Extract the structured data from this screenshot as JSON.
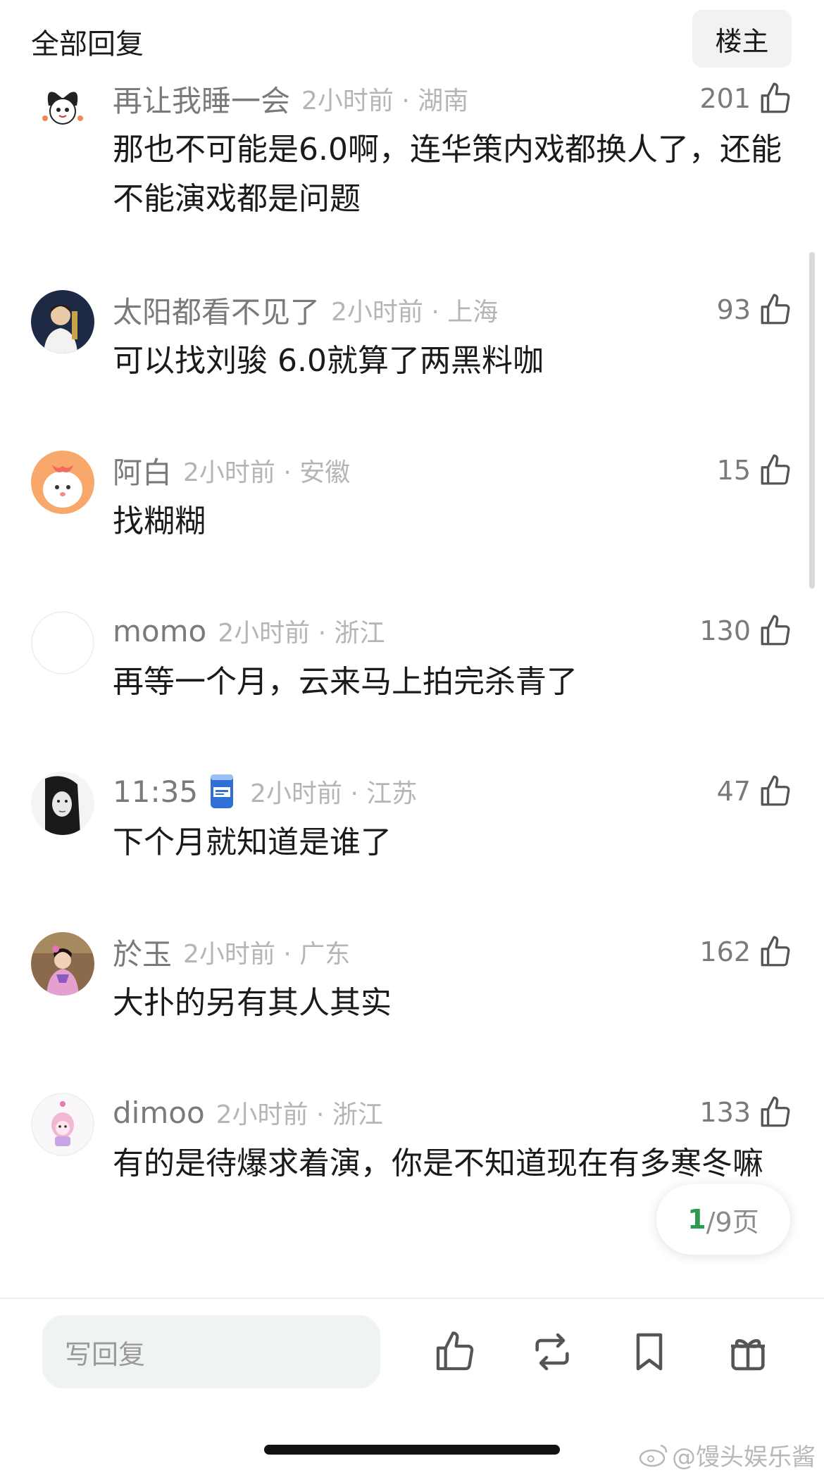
{
  "header": {
    "title": "全部回复",
    "op_toggle": "楼主"
  },
  "comments": [
    {
      "user": "再让我睡一会",
      "time": "2小时前 · 湖南",
      "likes": "201",
      "text": "那也不可能是6.0啊，连华策内戏都换人了，还能不能演戏都是问题"
    },
    {
      "user": "太阳都看不见了",
      "time": "2小时前 · 上海",
      "likes": "93",
      "text": "可以找刘骏 6.0就算了两黑料咖"
    },
    {
      "user": "阿白",
      "time": "2小时前 · 安徽",
      "likes": "15",
      "text": "找糊糊"
    },
    {
      "user": "momo",
      "time": "2小时前 · 浙江",
      "likes": "130",
      "text": "再等一个月，云来马上拍完杀青了"
    },
    {
      "user": "11:35",
      "time": "2小时前 · 江苏",
      "likes": "47",
      "text": "下个月就知道是谁了"
    },
    {
      "user": "於玉",
      "time": "2小时前 · 广东",
      "likes": "162",
      "text": "大扑的另有其人其实"
    },
    {
      "user": "dimoo",
      "time": "2小时前 · 浙江",
      "likes": "133",
      "text": "有的是待爆求着演，你是不知道现在有多寒冬嘛"
    }
  ],
  "pager": {
    "current": "1",
    "total": "/9页"
  },
  "bottom_bar": {
    "reply_placeholder": "写回复",
    "actions": [
      "thumb-up-icon",
      "repost-icon",
      "bookmark-icon",
      "gift-icon"
    ]
  },
  "watermark": "@馒头娱乐酱",
  "colors": {
    "accent_green": "#2e9a4f",
    "input_bg": "#eff4f1",
    "muted_text": "#7a7a7a",
    "faint_text": "#b5b5b5"
  }
}
